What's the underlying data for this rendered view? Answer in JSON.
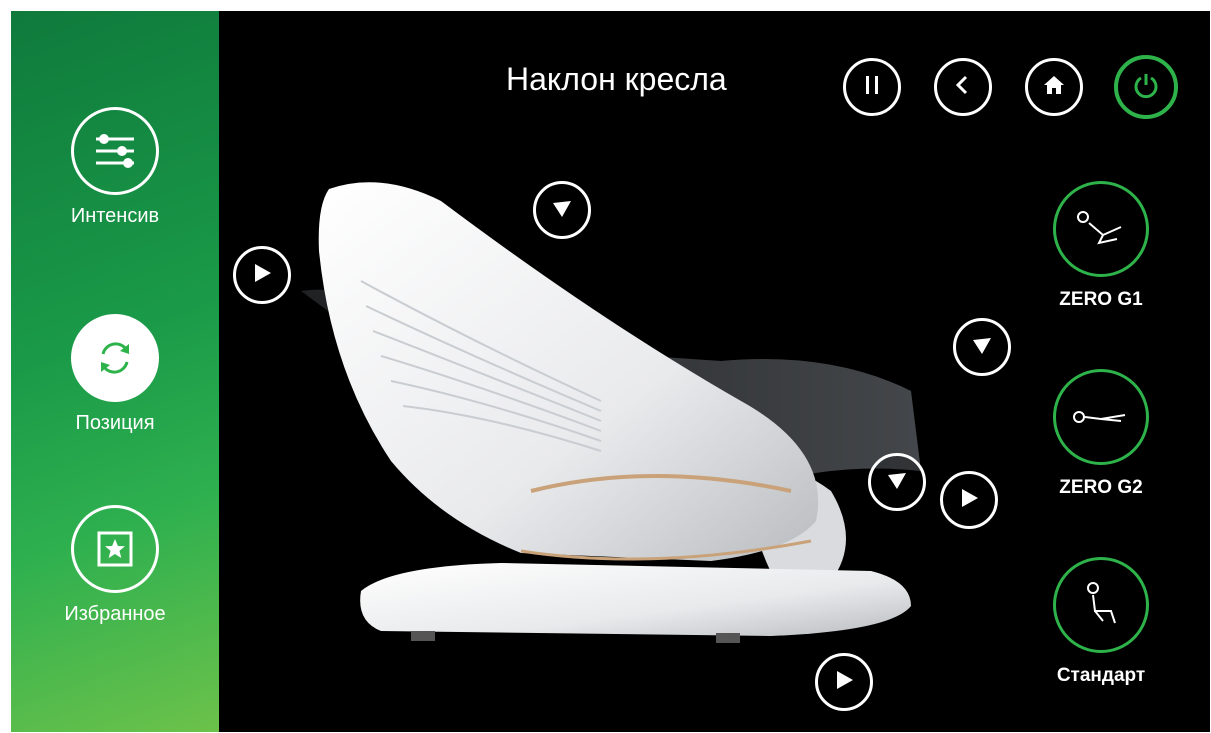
{
  "screen": {
    "title": "Наклон кресла"
  },
  "sidebar": {
    "items": [
      {
        "label": "Интенсив",
        "icon": "sliders-icon",
        "active": false
      },
      {
        "label": "Позиция",
        "icon": "rotate-icon",
        "active": true
      },
      {
        "label": "Избранное",
        "icon": "star-box-icon",
        "active": false
      }
    ]
  },
  "top_controls": [
    {
      "icon": "pause-icon"
    },
    {
      "icon": "back-icon"
    },
    {
      "icon": "home-icon"
    },
    {
      "icon": "power-icon",
      "color": "#2eb34b"
    }
  ],
  "positions": [
    {
      "label": "ZERO G1",
      "icon": "zero-g1-icon"
    },
    {
      "label": "ZERO G2",
      "icon": "zero-g2-icon"
    },
    {
      "label": "Стандарт",
      "icon": "standard-seat-icon"
    }
  ],
  "adjust_arrows": [
    {
      "name": "headrest-forward",
      "direction": "right"
    },
    {
      "name": "backrest-down",
      "direction": "down"
    },
    {
      "name": "legrest-down",
      "direction": "down"
    },
    {
      "name": "legrest-extend-down",
      "direction": "down"
    },
    {
      "name": "legrest-extend",
      "direction": "right"
    },
    {
      "name": "base-forward",
      "direction": "right"
    }
  ],
  "colors": {
    "accent": "#2eb34b",
    "sidebar_top": "#0f7a3c",
    "sidebar_bottom": "#6cc24a",
    "background": "#000000"
  }
}
